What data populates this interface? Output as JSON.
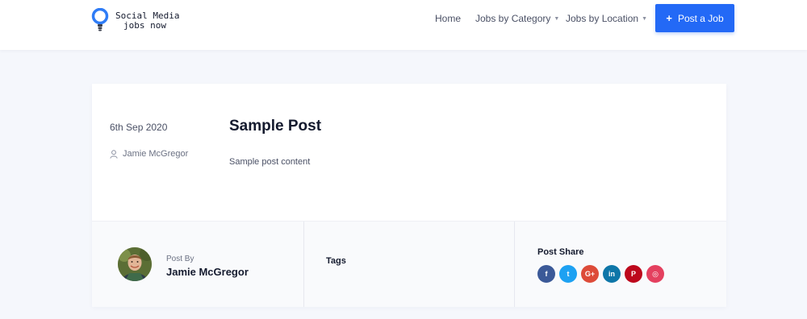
{
  "header": {
    "logo": {
      "line1": "Social Media",
      "line2": "jobs now"
    },
    "nav": [
      {
        "label": "Home",
        "has_caret": false
      },
      {
        "label": "Jobs by Category",
        "has_caret": true
      },
      {
        "label": "Jobs by Location",
        "has_caret": true
      }
    ],
    "cta": {
      "icon": "plus-icon",
      "label": "Post a Job"
    }
  },
  "post": {
    "date": "6th Sep 2020",
    "author": "Jamie McGregor",
    "title": "Sample Post",
    "content": "Sample post content"
  },
  "footer": {
    "post_by_label": "Post By",
    "post_by_name": "Jamie McGregor",
    "tags_label": "Tags",
    "share_label": "Post Share",
    "share_icons": [
      {
        "name": "facebook-icon",
        "glyph": "f",
        "color": "#3b5998"
      },
      {
        "name": "twitter-icon",
        "glyph": "t",
        "color": "#1da1f2"
      },
      {
        "name": "google-plus-icon",
        "glyph": "G+",
        "color": "#dd4b39"
      },
      {
        "name": "linkedin-icon",
        "glyph": "in",
        "color": "#0e76a8"
      },
      {
        "name": "pinterest-icon",
        "glyph": "P",
        "color": "#bd081c"
      },
      {
        "name": "instagram-icon",
        "glyph": "◎",
        "color": "#e4405f"
      }
    ]
  },
  "colors": {
    "accent": "#2369f6",
    "page_bg": "#f5f7fc"
  }
}
